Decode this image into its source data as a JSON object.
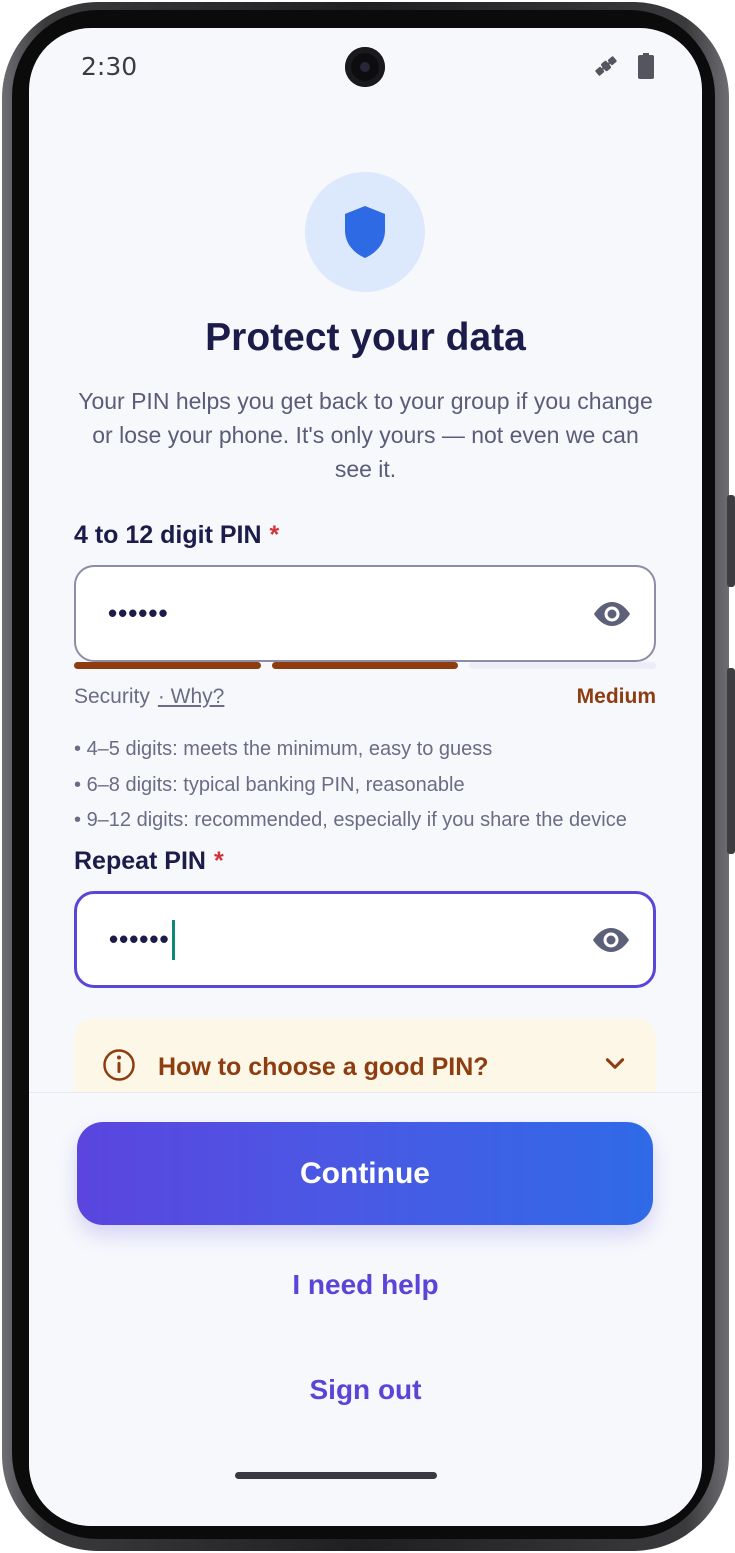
{
  "status_bar": {
    "time": "2:30",
    "icons": [
      "satellite-icon",
      "battery-icon"
    ]
  },
  "header": {
    "icon": "shield-icon",
    "title": "Protect your data",
    "subtitle": "Your PIN helps you get back to your group if you change or lose your phone. It's only yours — not even we can see it."
  },
  "pin": {
    "label": "4 to 12 digit PIN",
    "required_mark": "*",
    "value": "••••••",
    "eye_icon": "eye-icon"
  },
  "strength": {
    "label": "Security",
    "why_link": "· Why?",
    "level": "Medium",
    "segments_filled": 2,
    "segments_total": 3,
    "color": "#8d3d10"
  },
  "tips": [
    "4–5 digits: meets the minimum, easy to guess",
    "6–8 digits: typical banking PIN, reasonable",
    "9–12 digits: recommended, especially if you share the device"
  ],
  "repeat_pin": {
    "label": "Repeat PIN",
    "required_mark": "*",
    "value": "••••••",
    "eye_icon": "eye-icon"
  },
  "info_card": {
    "icon": "info-icon",
    "text": "How to choose a good PIN?",
    "expand_icon": "chevron-down-icon"
  },
  "actions": {
    "continue_label": "Continue",
    "help_label": "I need help",
    "signout_label": "Sign out"
  },
  "colors": {
    "accent": "#5a45d8",
    "title": "#1c1c4a",
    "required": "#d1333a",
    "warning": "#8d3d10"
  }
}
